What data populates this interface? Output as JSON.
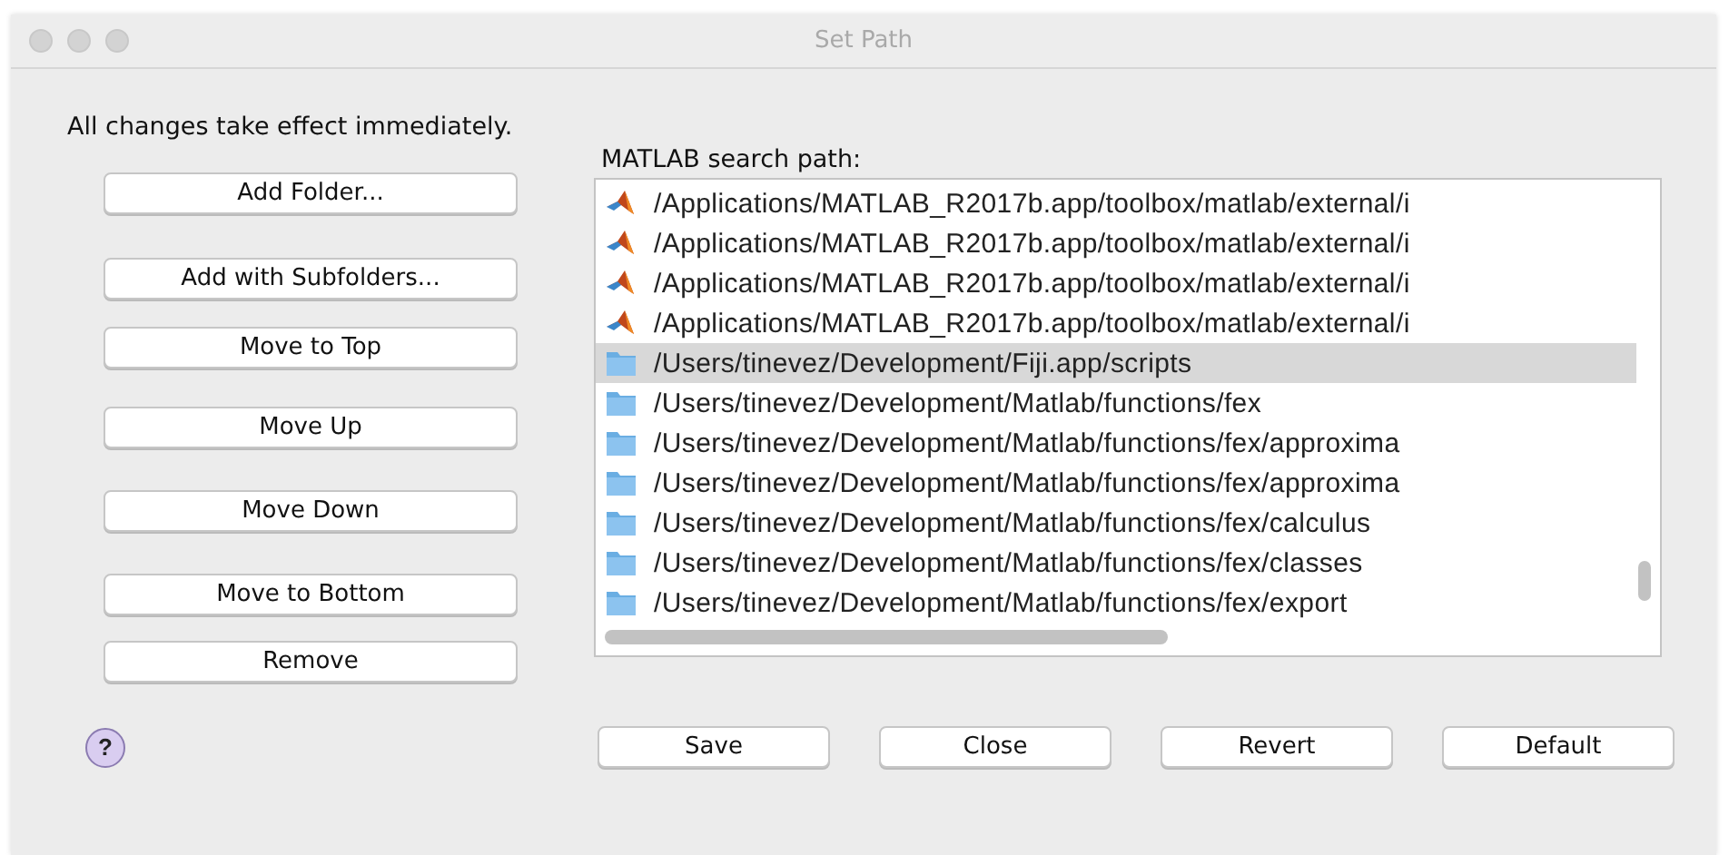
{
  "window": {
    "title": "Set Path"
  },
  "message": "All changes take effect immediately.",
  "side_buttons": [
    "Add Folder...",
    "Add with Subfolders...",
    "Move to Top",
    "Move Up",
    "Move Down",
    "Move to Bottom",
    "Remove"
  ],
  "path_list": {
    "label": "MATLAB search path:",
    "items": [
      {
        "kind": "matlab",
        "path": "/Applications/MATLAB_R2017b.app/toolbox/matlab/external/i",
        "selected": false
      },
      {
        "kind": "matlab",
        "path": "/Applications/MATLAB_R2017b.app/toolbox/matlab/external/i",
        "selected": false
      },
      {
        "kind": "matlab",
        "path": "/Applications/MATLAB_R2017b.app/toolbox/matlab/external/i",
        "selected": false
      },
      {
        "kind": "matlab",
        "path": "/Applications/MATLAB_R2017b.app/toolbox/matlab/external/i",
        "selected": false
      },
      {
        "kind": "folder",
        "path": "/Users/tinevez/Development/Fiji.app/scripts",
        "selected": true
      },
      {
        "kind": "folder",
        "path": "/Users/tinevez/Development/Matlab/functions/fex",
        "selected": false
      },
      {
        "kind": "folder",
        "path": "/Users/tinevez/Development/Matlab/functions/fex/approxima",
        "selected": false
      },
      {
        "kind": "folder",
        "path": "/Users/tinevez/Development/Matlab/functions/fex/approxima",
        "selected": false
      },
      {
        "kind": "folder",
        "path": "/Users/tinevez/Development/Matlab/functions/fex/calculus",
        "selected": false
      },
      {
        "kind": "folder",
        "path": "/Users/tinevez/Development/Matlab/functions/fex/classes",
        "selected": false
      },
      {
        "kind": "folder",
        "path": "/Users/tinevez/Development/Matlab/functions/fex/export",
        "selected": false
      }
    ]
  },
  "help": {
    "label": "?"
  },
  "bottom_buttons": [
    "Save",
    "Close",
    "Revert",
    "Default"
  ]
}
